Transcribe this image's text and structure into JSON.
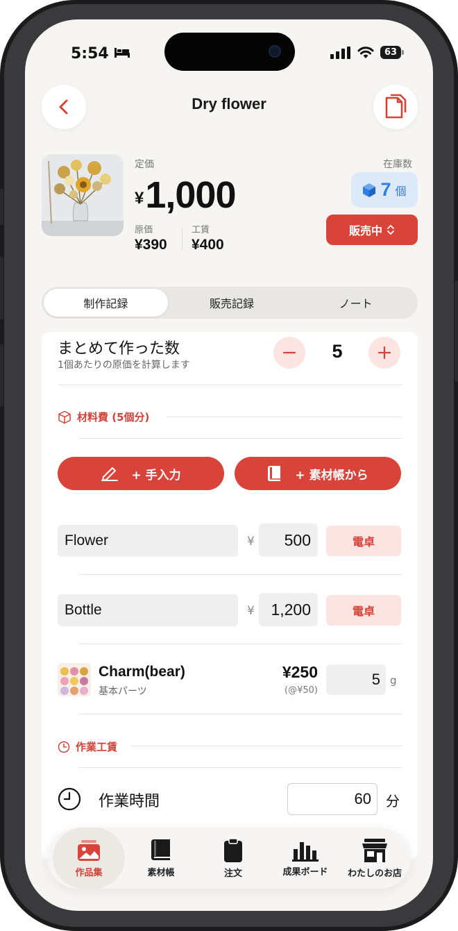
{
  "status_bar": {
    "time": "5:54",
    "battery": "63"
  },
  "header": {
    "title": "Dry flower"
  },
  "product": {
    "list_price_label": "定価",
    "currency": "¥",
    "list_price": "1,000",
    "cost_label": "原価",
    "cost": "¥390",
    "labor_label": "工賃",
    "labor": "¥400",
    "stock_label": "在庫数",
    "stock_count": "7",
    "stock_unit": "個",
    "sale_status": "販売中"
  },
  "tabs": [
    {
      "label": "制作記録"
    },
    {
      "label": "販売記録"
    },
    {
      "label": "ノート"
    }
  ],
  "batch": {
    "title": "まとめて作った数",
    "subtitle": "1個あたりの原価を計算します",
    "quantity": "5"
  },
  "materials": {
    "section_title": "材料費 (5個分)",
    "manual_button": "+ 手入力",
    "book_button": "+ 素材帳から",
    "yen": "¥",
    "calc_label": "電卓",
    "items": [
      {
        "name": "Flower",
        "amount": "500"
      },
      {
        "name": "Bottle",
        "amount": "1,200"
      }
    ],
    "library_item": {
      "name": "Charm(bear)",
      "category": "基本パーツ",
      "price": "¥250",
      "unit_price": "(@¥50)",
      "quantity": "5",
      "unit": "g"
    }
  },
  "labor": {
    "section_title": "作業工賃",
    "time_label": "作業時間",
    "minutes": "60",
    "minutes_unit": "分"
  },
  "tabbar": {
    "items": [
      {
        "label": "作品集",
        "icon": "gallery-icon"
      },
      {
        "label": "素材帳",
        "icon": "book-icon"
      },
      {
        "label": "注文",
        "icon": "clipboard-icon"
      },
      {
        "label": "成果ボード",
        "icon": "bar-chart-icon"
      },
      {
        "label": "わたしのお店",
        "icon": "shop-icon"
      }
    ]
  },
  "colors": {
    "accent": "#d9443a",
    "stock": "#2f7fe2",
    "background": "#f7f5f2"
  }
}
